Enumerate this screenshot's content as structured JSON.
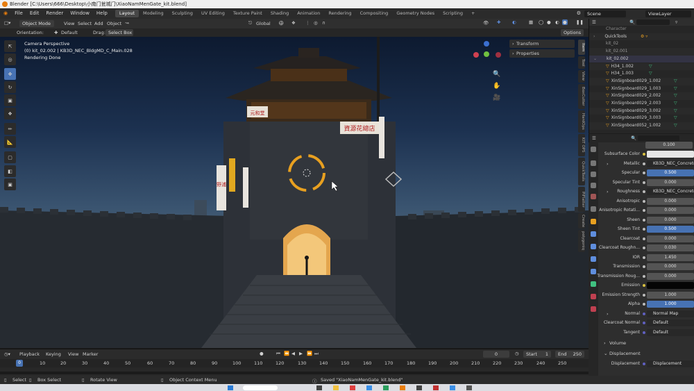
{
  "titlebar": {
    "title": "Blender [C:\\Users\\666\\Desktop\\小南门瓮城门\\XiaoNamMenGate_kit.blend]"
  },
  "menu": [
    "File",
    "Edit",
    "Render",
    "Window",
    "Help"
  ],
  "workspaces": [
    "Layout",
    "Modeling",
    "Sculpting",
    "UV Editing",
    "Texture Paint",
    "Shading",
    "Animation",
    "Rendering",
    "Compositing",
    "Geometry Nodes",
    "Scripting"
  ],
  "workspace_add": "+",
  "scene": {
    "scene_name": "Scene",
    "view_layer": "ViewLayer"
  },
  "header": {
    "mode": "Object Mode",
    "menus": [
      "View",
      "Select",
      "Add",
      "Object"
    ],
    "transform_orientation": "Global",
    "options_label": "Options"
  },
  "tool_settings": {
    "orientation_label": "Orientation:",
    "orientation_value": "Default",
    "drag_label": "Drag:",
    "drag_value": "Select Box"
  },
  "viewport": {
    "info_line1": "Camera Perspective",
    "info_line2": "(0) kit_02.002 | KB3D_NEC_BldgMD_C_Main.028",
    "info_line3": "Rendering Done",
    "sign_right": "資源花總店",
    "sign_left": "元和堂",
    "sign_vertical": "野浦"
  },
  "npanel": {
    "sections": [
      "Transform",
      "Properties"
    ],
    "tabs": [
      "Item",
      "Tool",
      "View",
      "BoxCutter",
      "HardOps",
      "KIT OPS",
      "QuickTools",
      "PiFlatter",
      "Create",
      "polygoniq"
    ]
  },
  "outliner": {
    "rows": [
      "Character",
      "QuickTools",
      "kit_02",
      "kit_02.001",
      "kit_02.002",
      "H34_1.002",
      "H34_1.003",
      "XinSignboard029_1.002",
      "XinSignboard029_1.003",
      "XinSignboard029_2.002",
      "XinSignboard029_2.003",
      "XinSignboard029_3.002",
      "XinSignboard029_3.003",
      "XinSignboard052_1.002"
    ]
  },
  "properties": {
    "top_value": "0.100",
    "rows": [
      {
        "label": "Subsurface Color",
        "value": "",
        "style": "white"
      },
      {
        "label": "Metallic",
        "value": "KB3D_NEC_ConcreteBl",
        "style": "link"
      },
      {
        "label": "Specular",
        "value": "0.500",
        "style": "blue"
      },
      {
        "label": "Specular Tint",
        "value": "0.000",
        "style": ""
      },
      {
        "label": "Roughness",
        "value": "KB3D_NEC_ConcreteBl",
        "style": "link"
      },
      {
        "label": "Anisotropic",
        "value": "0.000",
        "style": ""
      },
      {
        "label": "Anisotropic Rotati...",
        "value": "0.000",
        "style": ""
      },
      {
        "label": "Sheen",
        "value": "0.000",
        "style": ""
      },
      {
        "label": "Sheen Tint",
        "value": "0.500",
        "style": "blue"
      },
      {
        "label": "Clearcoat",
        "value": "0.000",
        "style": ""
      },
      {
        "label": "Clearcoat Roughn...",
        "value": "0.030",
        "style": ""
      },
      {
        "label": "IOR",
        "value": "1.450",
        "style": ""
      },
      {
        "label": "Transmission",
        "value": "0.000",
        "style": ""
      },
      {
        "label": "Transmission Roug...",
        "value": "0.000",
        "style": ""
      },
      {
        "label": "Emission",
        "value": "",
        "style": "black"
      },
      {
        "label": "Emission Strength",
        "value": "1.000",
        "style": ""
      },
      {
        "label": "Alpha",
        "value": "1.000",
        "style": "blue"
      },
      {
        "label": "Normal",
        "value": "Normal Map",
        "style": "link"
      },
      {
        "label": "Clearcoat Normal",
        "value": "Default",
        "style": "link"
      },
      {
        "label": "Tangent",
        "value": "Default",
        "style": "link"
      }
    ],
    "volume_label": "Volume",
    "displacement_label": "Displacement",
    "displacement_row_label": "Displacement",
    "displacement_row_value": "Displacement"
  },
  "timeline": {
    "menus": [
      "Playback",
      "Keying",
      "View",
      "Marker"
    ],
    "current_frame": "0",
    "start_label": "Start",
    "start_value": "1",
    "end_label": "End",
    "end_value": "250",
    "ticks": [
      "0",
      "10",
      "20",
      "30",
      "40",
      "50",
      "60",
      "70",
      "80",
      "90",
      "100",
      "110",
      "120",
      "130",
      "140",
      "150",
      "160",
      "170",
      "180",
      "190",
      "200",
      "210",
      "220",
      "230",
      "240",
      "250"
    ]
  },
  "statusbar": {
    "select": "Select",
    "box_select": "Box Select",
    "rotate_view": "Rotate View",
    "context_menu": "Object Context Menu",
    "message": "Saved \"XiaoNamMenGate_kit.blend\""
  },
  "colors": {
    "accent": "#4772b3",
    "orange": "#e87d0d",
    "header": "#2b2b2b"
  }
}
